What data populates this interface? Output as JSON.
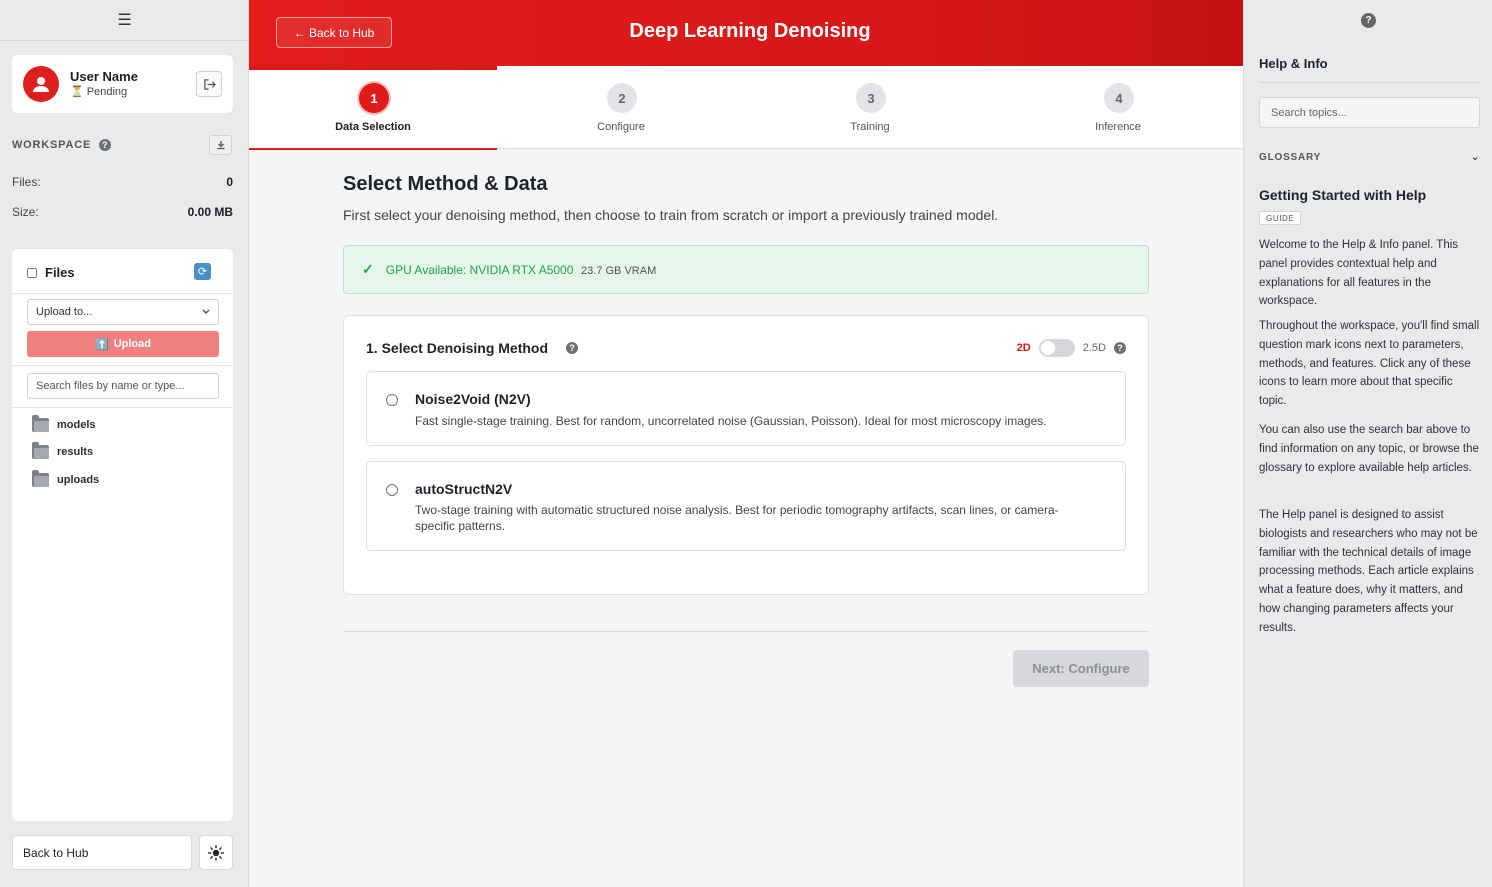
{
  "sidebar": {
    "menu_icon": "☰",
    "user": {
      "name": "User Name",
      "status_icon": "⏳",
      "status": "Pending"
    },
    "workspace": {
      "label": "WORKSPACE",
      "files_label": "Files:",
      "files_value": "0",
      "size_label": "Size:",
      "size_value": "0.00 MB"
    },
    "files": {
      "title": "Files",
      "upload_target_placeholder": "Upload to...",
      "upload_icon": "⬆️",
      "upload_label": "Upload",
      "search_placeholder": "Search files by name or type...",
      "folders": [
        "models",
        "results",
        "uploads"
      ]
    },
    "back_hub": "Back to Hub"
  },
  "header": {
    "back_label": "← Back to Hub",
    "title": "Deep Learning Denoising",
    "accent_color": "#e01b1b"
  },
  "steps": [
    {
      "num": "1",
      "label": "Data Selection",
      "active": true
    },
    {
      "num": "2",
      "label": "Configure",
      "active": false
    },
    {
      "num": "3",
      "label": "Training",
      "active": false
    },
    {
      "num": "4",
      "label": "Inference",
      "active": false
    }
  ],
  "main": {
    "title": "Select Method & Data",
    "description": "First select your denoising method, then choose to train from scratch or import a previously trained model.",
    "gpu": {
      "check": "✓",
      "text": "GPU Available: NVIDIA RTX A5000",
      "vram": "23.7 GB VRAM"
    },
    "method_card": {
      "title": "1. Select Denoising Method",
      "dim_2d": "2D",
      "dim_25d": "2.5D",
      "options": [
        {
          "name": "Noise2Void (N2V)",
          "desc": "Fast single-stage training. Best for random, uncorrelated noise (Gaussian, Poisson). Ideal for most microscopy images."
        },
        {
          "name": "autoStructN2V",
          "desc": "Two-stage training with automatic structured noise analysis. Best for periodic tomography artifacts, scan lines, or camera-specific patterns."
        }
      ]
    },
    "next_label": "Next: Configure"
  },
  "help": {
    "title": "Help & Info",
    "search_placeholder": "Search topics...",
    "glossary_label": "GLOSSARY",
    "glossary_chevron": "⌄",
    "article_title": "Getting Started with Help",
    "badge": "GUIDE",
    "paragraphs": [
      "Welcome to the Help & Info panel. This panel provides contextual help and explanations for all features in the workspace.",
      "Throughout the workspace, you'll find small question mark icons next to parameters, methods, and features. Click any of these icons to learn more about that specific topic.",
      "You can also use the search bar above to find information on any topic, or browse the glossary to explore available help articles.",
      "The Help panel is designed to assist biologists and researchers who may not be familiar with the technical details of image processing methods. Each article explains what a feature does, why it matters, and how changing parameters affects your results."
    ]
  }
}
